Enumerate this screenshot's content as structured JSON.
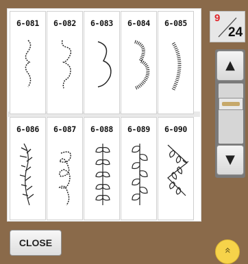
{
  "stitches": [
    {
      "code": "6-081",
      "icon": "scallop-bracket-stitch-icon"
    },
    {
      "code": "6-082",
      "icon": "bump-bracket-stitch-icon"
    },
    {
      "code": "6-083",
      "icon": "double-scallop-stitch-icon"
    },
    {
      "code": "6-084",
      "icon": "satin-scallop-stitch-icon"
    },
    {
      "code": "6-085",
      "icon": "satin-curve-stitch-icon"
    },
    {
      "code": "6-086",
      "icon": "feather-stitch-icon"
    },
    {
      "code": "6-087",
      "icon": "looped-vine-stitch-icon"
    },
    {
      "code": "6-088",
      "icon": "leaf-vine-stitch-icon"
    },
    {
      "code": "6-089",
      "icon": "leaf-vine-alt-stitch-icon"
    },
    {
      "code": "6-090",
      "icon": "diagonal-leaf-stitch-icon"
    }
  ],
  "page": {
    "current": "9",
    "total": "24"
  },
  "scroll": {
    "up_icon": "▲",
    "down_icon": "▼"
  },
  "close_label": "CLOSE",
  "expand_icon": "»"
}
